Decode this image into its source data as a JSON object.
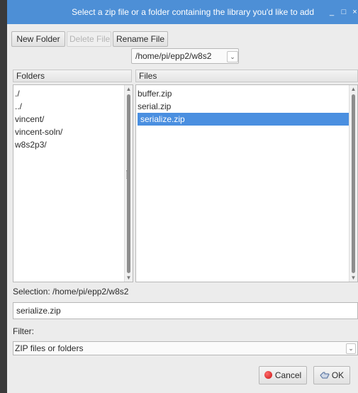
{
  "window": {
    "title": "Select a zip file or a folder containing the library you'd like to add",
    "minimize_glyph": "_",
    "maximize_glyph": "□",
    "close_glyph": "×"
  },
  "toolbar": {
    "new_folder_label": "New Folder",
    "delete_file_label": "Delete File",
    "rename_file_label": "Rename File"
  },
  "path_combo": {
    "value": "/home/pi/epp2/w8s2",
    "arrow_glyph": "⌄"
  },
  "folders": {
    "header": "Folders",
    "items": [
      "./",
      "../",
      "vincent/",
      "vincent-soln/",
      "w8s2p3/"
    ]
  },
  "files": {
    "header": "Files",
    "items": [
      "buffer.zip",
      "serial.zip",
      "serialize.zip"
    ],
    "selected_index": 2
  },
  "selection": {
    "label": "Selection: /home/pi/epp2/w8s2",
    "value": "serialize.zip"
  },
  "filter": {
    "label": "Filter:",
    "value": "ZIP files or folders",
    "arrow_glyph": "⌄"
  },
  "buttons": {
    "cancel_label": "Cancel",
    "ok_label": "OK"
  },
  "icons": {
    "cancel": "stop-icon",
    "ok": "ok-hand-icon",
    "scroll_up": "scroll-up-arrow-icon",
    "scroll_down": "scroll-down-arrow-icon"
  },
  "colors": {
    "titlebar": "#4d8fd6",
    "selection": "#4a8fe0",
    "window_bg": "#ececec"
  }
}
